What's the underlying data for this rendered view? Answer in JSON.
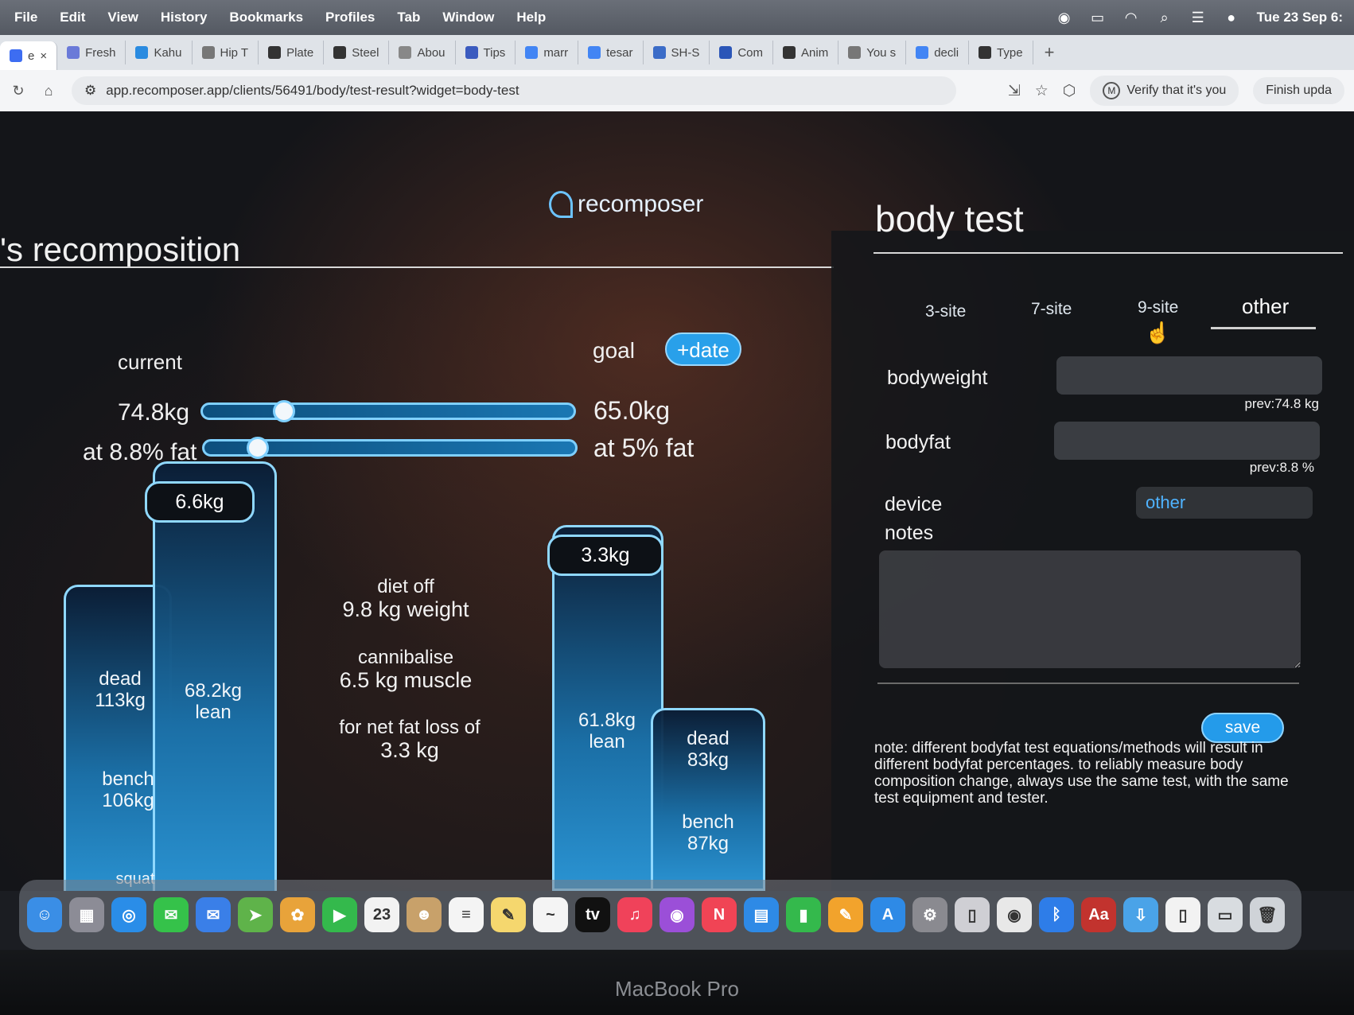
{
  "menubar": {
    "items": [
      "File",
      "Edit",
      "View",
      "History",
      "Bookmarks",
      "Profiles",
      "Tab",
      "Window",
      "Help"
    ],
    "clock": "Tue 23 Sep 6:"
  },
  "tabs": [
    {
      "label": "e",
      "color": "#3d6df2",
      "active": true
    },
    {
      "label": "Fresh",
      "color": "#6a7ad8"
    },
    {
      "label": "Kahu",
      "color": "#2a8be0"
    },
    {
      "label": "Hip T",
      "color": "#777777"
    },
    {
      "label": "Plate",
      "color": "#333333"
    },
    {
      "label": "Steel",
      "color": "#333333"
    },
    {
      "label": "Abou",
      "color": "#888888"
    },
    {
      "label": "Tips",
      "color": "#3b5bbf"
    },
    {
      "label": "marr",
      "color": "#4285f4"
    },
    {
      "label": "tesar",
      "color": "#4285f4"
    },
    {
      "label": "SH-S",
      "color": "#3b6cc8"
    },
    {
      "label": "Com",
      "color": "#2b56b8"
    },
    {
      "label": "Anim",
      "color": "#333333"
    },
    {
      "label": "You s",
      "color": "#777777"
    },
    {
      "label": "decli",
      "color": "#4285f4"
    },
    {
      "label": "Type",
      "color": "#333333"
    }
  ],
  "toolbar": {
    "url": "app.recomposer.app/clients/56491/body/test-result?widget=body-test",
    "verify_label": "Verify that it's you",
    "finish_label": "Finish upda"
  },
  "app": {
    "brand": "recomposer",
    "left_title": "'s recomposition",
    "current_label": "current",
    "goal_label": "goal",
    "date_button": "+date",
    "current_weight": "74.8kg",
    "current_fat": "at 8.8% fat",
    "goal_weight": "65.0kg",
    "goal_fat": "at 5% fat",
    "weight_slider_fraction": 0.2,
    "fat_slider_fraction": 0.12,
    "current_fat_cap": "6.6kg",
    "current_lean": "68.2kg\nlean",
    "current_dead": "dead\n113kg",
    "current_bench": "bench\n106kg",
    "current_squat": "squat",
    "diet_off_1": "diet off",
    "diet_off_2": "9.8 kg weight",
    "cannibalise_1": "cannibalise",
    "cannibalise_2": "6.5 kg muscle",
    "net_loss_1": "for net fat loss of",
    "net_loss_2": "3.3 kg",
    "goal_fat_cap": "3.3kg",
    "goal_lean": "61.8kg\nlean",
    "goal_dead": "dead\n83kg",
    "goal_bench": "bench\n87kg"
  },
  "panel": {
    "title": "body test",
    "tabs": [
      "3-site",
      "7-site",
      "9-site",
      "other"
    ],
    "active_tab": "other",
    "bodyweight_label": "bodyweight",
    "bodyweight_prev": "prev:74.8 kg",
    "bodyfat_label": "bodyfat",
    "bodyfat_prev": "prev:8.8 %",
    "device_label": "device",
    "device_value": "other",
    "notes_label": "notes",
    "save_label": "save",
    "note_text": "note: different bodyfat test equations/methods will result in different bodyfat percentages. to reliably measure body composition change, always use the same test, with the same test equipment and tester."
  },
  "dock": [
    {
      "name": "finder",
      "color": "#3a8ee6",
      "glyph": "☺"
    },
    {
      "name": "launchpad",
      "color": "#8c8c96",
      "glyph": "▦"
    },
    {
      "name": "safari",
      "color": "#2a8de8",
      "glyph": "◎"
    },
    {
      "name": "messages",
      "color": "#35c24a",
      "glyph": "✉"
    },
    {
      "name": "mail",
      "color": "#3a7fe8",
      "glyph": "✉"
    },
    {
      "name": "maps",
      "color": "#5fb34a",
      "glyph": "➤"
    },
    {
      "name": "photos",
      "color": "#e8a33a",
      "glyph": "✿"
    },
    {
      "name": "facetime",
      "color": "#34b94c",
      "glyph": "▶"
    },
    {
      "name": "calendar",
      "color": "#f2f2f2",
      "glyph": "23"
    },
    {
      "name": "contacts",
      "color": "#c8a16a",
      "glyph": "☻"
    },
    {
      "name": "reminders",
      "color": "#f4f4f4",
      "glyph": "≡"
    },
    {
      "name": "notes",
      "color": "#f5d76e",
      "glyph": "✎"
    },
    {
      "name": "freeform",
      "color": "#f4f4f4",
      "glyph": "~"
    },
    {
      "name": "tv",
      "color": "#111111",
      "glyph": "tv"
    },
    {
      "name": "music",
      "color": "#f0425a",
      "glyph": "♫"
    },
    {
      "name": "podcasts",
      "color": "#9b4fd8",
      "glyph": "◉"
    },
    {
      "name": "news",
      "color": "#f04455",
      "glyph": "N"
    },
    {
      "name": "keynote",
      "color": "#2e8ae6",
      "glyph": "▤"
    },
    {
      "name": "numbers",
      "color": "#34b94c",
      "glyph": "▮"
    },
    {
      "name": "pages",
      "color": "#f2a32c",
      "glyph": "✎"
    },
    {
      "name": "app-store",
      "color": "#2e8ae6",
      "glyph": "A"
    },
    {
      "name": "system-settings",
      "color": "#8a8a90",
      "glyph": "⚙"
    },
    {
      "name": "iphone-mirroring",
      "color": "#cfcfd4",
      "glyph": "▯"
    },
    {
      "name": "chrome",
      "color": "#e8e8e8",
      "glyph": "◉"
    },
    {
      "name": "bluetooth",
      "color": "#2e7de8",
      "glyph": "ᛒ"
    },
    {
      "name": "dictionary",
      "color": "#c2332e",
      "glyph": "Aa"
    },
    {
      "name": "downloads",
      "color": "#4aa3e8",
      "glyph": "⇩"
    },
    {
      "name": "document",
      "color": "#f2f2f2",
      "glyph": "▯"
    },
    {
      "name": "preview-window",
      "color": "#d8dce0",
      "glyph": "▭"
    },
    {
      "name": "trash",
      "color": "#cfd3d8",
      "glyph": "🗑"
    }
  ],
  "laptop_label": "MacBook Pro"
}
